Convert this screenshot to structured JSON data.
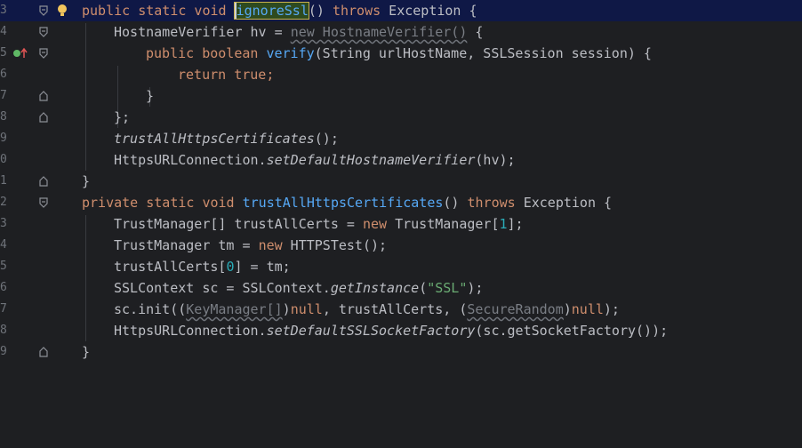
{
  "editor": {
    "line_numbers": [
      "3",
      "4",
      "5",
      "6",
      "7",
      "8",
      "9",
      "0",
      "1",
      "2",
      "3",
      "4",
      "5",
      "6",
      "7",
      "8",
      "9"
    ],
    "icons": {
      "bulb": "lightbulb-icon",
      "implement": "implement-marker-icon",
      "fold": "fold-marker-icon"
    },
    "colors": {
      "background": "#1e1f22",
      "current_line": "#0f1846",
      "keyword": "#cf8e6d",
      "method": "#56a8f5",
      "number": "#2aacb8",
      "string": "#6aab73"
    },
    "lines": [
      {
        "t1": "public static void ",
        "t2": "ignoreSsl",
        "t3": "() ",
        "t4": "throws",
        "t5": " Exception {"
      },
      {
        "t1": "HostnameVerifier hv = ",
        "t2": "new HostnameVerifier()",
        "t3": " {"
      },
      {
        "t1": "public boolean ",
        "t2": "verify",
        "t3": "(String urlHostName, SSLSession session) {"
      },
      {
        "t1": "return ",
        "t2": "true",
        "t3": ";"
      },
      {
        "t1": "}"
      },
      {
        "t1": "};"
      },
      {
        "t1": "trustAllHttpsCertificates",
        "t2": "();"
      },
      {
        "t1": "HttpsURLConnection.",
        "t2": "setDefaultHostnameVerifier",
        "t3": "(hv);"
      },
      {
        "t1": "}"
      },
      {
        "t1": "private static void ",
        "t2": "trustAllHttpsCertificates",
        "t3": "() ",
        "t4": "throws",
        "t5": " Exception {"
      },
      {
        "t1": "TrustManager[] trustAllCerts = ",
        "t2": "new",
        "t3": " TrustManager[",
        "t4": "1",
        "t5": "];"
      },
      {
        "t1": "TrustManager tm = ",
        "t2": "new",
        "t3": " HTTPSTest();"
      },
      {
        "t1": "trustAllCerts[",
        "t2": "0",
        "t3": "] = tm;"
      },
      {
        "t1": "SSLContext sc = SSLContext.",
        "t2": "getInstance",
        "t3": "(",
        "t4": "\"SSL\"",
        "t5": ");"
      },
      {
        "t1": "sc.init((",
        "t2": "KeyManager[]",
        "t3": ")",
        "t4": "null",
        "t5": ", trustAllCerts, (",
        "t6": "SecureRandom",
        "t7": ")",
        "t8": "null",
        "t9": ");"
      },
      {
        "t1": "HttpsURLConnection.",
        "t2": "setDefaultSSLSocketFactory",
        "t3": "(sc.getSocketFactory());"
      },
      {
        "t1": "}"
      }
    ]
  }
}
